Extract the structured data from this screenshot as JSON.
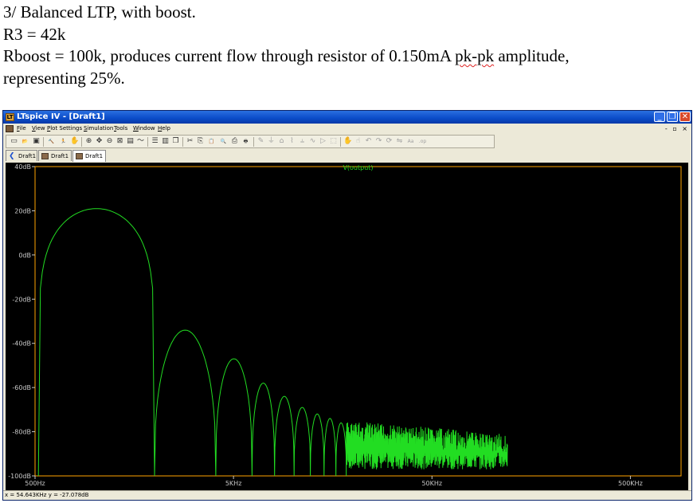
{
  "caption": {
    "line1": "3/ Balanced LTP, with boost.",
    "line2": "R3 = 42k",
    "line3_pre": "Rboost = 100k, produces current flow through resistor of 0.150mA ",
    "line3_ul": "pk-pk",
    "line3_post": " amplitude,",
    "line4": "representing 25%."
  },
  "window": {
    "title": "LTspice IV - [Draft1]",
    "controls": [
      "_",
      "❐",
      "✕"
    ],
    "mdi_controls": "- ▫ ×"
  },
  "menu": [
    "File",
    "View",
    "Plot Settings",
    "Simulation",
    "Tools",
    "Window",
    "Help"
  ],
  "toolbar_icons": [
    {
      "name": "new-schematic-icon",
      "glyph": "▭"
    },
    {
      "name": "open-icon",
      "glyph": "📂"
    },
    {
      "name": "save-icon",
      "glyph": "▣"
    },
    {
      "name": "control-panel-icon",
      "glyph": "🔨"
    },
    {
      "name": "run-icon",
      "glyph": "🏃"
    },
    {
      "name": "halt-icon",
      "glyph": "✋"
    },
    {
      "name": "zoom-in-icon",
      "glyph": "⊕"
    },
    {
      "name": "zoom-pan-icon",
      "glyph": "✥"
    },
    {
      "name": "zoom-out-icon",
      "glyph": "⊖"
    },
    {
      "name": "zoom-fit-icon",
      "glyph": "⊠"
    },
    {
      "name": "autorange-icon",
      "glyph": "▤"
    },
    {
      "name": "waveform-icon",
      "glyph": "〜"
    },
    {
      "name": "tile-horizontal-icon",
      "glyph": "☰"
    },
    {
      "name": "tile-vertical-icon",
      "glyph": "▥"
    },
    {
      "name": "cascade-icon",
      "glyph": "❐"
    },
    {
      "name": "cut-icon",
      "glyph": "✂"
    },
    {
      "name": "copy-icon",
      "glyph": "⎘"
    },
    {
      "name": "paste-icon",
      "glyph": "📋"
    },
    {
      "name": "find-icon",
      "glyph": "🔍"
    },
    {
      "name": "print-setup-icon",
      "glyph": "⎙"
    },
    {
      "name": "print-icon",
      "glyph": "🖶"
    },
    {
      "name": "wire-icon",
      "glyph": "✎"
    },
    {
      "name": "ground-icon",
      "glyph": "⏚"
    },
    {
      "name": "label-icon",
      "glyph": "⌂"
    },
    {
      "name": "resistor-icon",
      "glyph": "⌇"
    },
    {
      "name": "capacitor-icon",
      "glyph": "⫨"
    },
    {
      "name": "inductor-icon",
      "glyph": "∿"
    },
    {
      "name": "diode-icon",
      "glyph": "▷"
    },
    {
      "name": "component-icon",
      "glyph": "⬚"
    },
    {
      "name": "move-icon",
      "glyph": "✋"
    },
    {
      "name": "drag-icon",
      "glyph": "☝"
    },
    {
      "name": "undo-icon",
      "glyph": "↶"
    },
    {
      "name": "redo-icon",
      "glyph": "↷"
    },
    {
      "name": "rotate-icon",
      "glyph": "⟳"
    },
    {
      "name": "mirror-icon",
      "glyph": "⇋"
    },
    {
      "name": "text-icon",
      "glyph": "Aa"
    },
    {
      "name": "spice-directive-icon",
      "glyph": ".op"
    }
  ],
  "tabs": [
    {
      "label": "Draft1",
      "icon": "schematic"
    },
    {
      "label": "Draft1",
      "icon": "doc"
    },
    {
      "label": "Draft1",
      "icon": "doc",
      "active": true
    }
  ],
  "status": {
    "text": "x = 54.643KHz   y = -27.078dB"
  },
  "colors": {
    "trace": "#22dd22",
    "frame": "#ffa500",
    "label": "#c8c8c8",
    "background": "#000000"
  },
  "chart_data": {
    "type": "line",
    "title": "V(output)",
    "x_scale": "log",
    "x_unit": "Hz",
    "xlim": [
      500,
      900000
    ],
    "ylim": [
      -100,
      40
    ],
    "x_ticks": [
      {
        "v": 500,
        "label": "500Hz"
      },
      {
        "v": 5000,
        "label": "5KHz"
      },
      {
        "v": 50000,
        "label": "50KHz"
      },
      {
        "v": 500000,
        "label": "500KHz"
      }
    ],
    "y_ticks": [
      {
        "v": 40,
        "label": "40dB"
      },
      {
        "v": 20,
        "label": "20dB"
      },
      {
        "v": 0,
        "label": "0dB"
      },
      {
        "v": -20,
        "label": "-20dB"
      },
      {
        "v": -40,
        "label": "-40dB"
      },
      {
        "v": -60,
        "label": "-60dB"
      },
      {
        "v": -80,
        "label": "-80dB"
      },
      {
        "v": -100,
        "label": "-100dB"
      }
    ],
    "series": [
      {
        "name": "V(output)",
        "main_lobe": {
          "start_hz": 520,
          "peak_hz": 1310,
          "peak_db": 21,
          "end_hz": 2000
        },
        "side_lobes": [
          {
            "start_hz": 2000,
            "peak_hz": 3100,
            "peak_db": -34,
            "end_hz": 4070
          },
          {
            "start_hz": 4070,
            "peak_hz": 5150,
            "peak_db": -47,
            "end_hz": 6200
          },
          {
            "start_hz": 6200,
            "peak_hz": 7000,
            "peak_db": -58,
            "end_hz": 8050
          },
          {
            "start_hz": 8050,
            "peak_hz": 9000,
            "peak_db": -64,
            "end_hz": 10100
          },
          {
            "start_hz": 10100,
            "peak_hz": 11100,
            "peak_db": -69,
            "end_hz": 12200
          },
          {
            "start_hz": 12200,
            "peak_hz": 13200,
            "peak_db": -72,
            "end_hz": 14300
          },
          {
            "start_hz": 14300,
            "peak_hz": 15300,
            "peak_db": -74,
            "end_hz": 16400
          },
          {
            "start_hz": 16400,
            "peak_hz": 17400,
            "peak_db": -76,
            "end_hz": 18500
          }
        ],
        "noise_region": {
          "start_hz": 18500,
          "end_hz": 120000,
          "high_db": -75,
          "low_db": -97
        }
      }
    ]
  }
}
